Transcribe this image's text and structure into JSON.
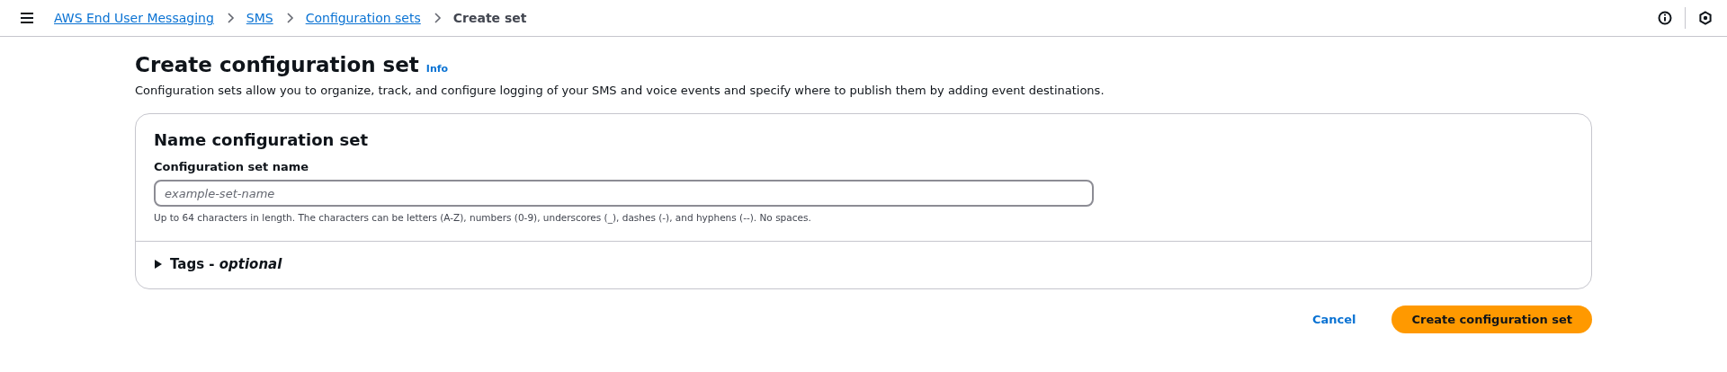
{
  "breadcrumbs": [
    {
      "label": "AWS End User Messaging",
      "current": false
    },
    {
      "label": "SMS",
      "current": false
    },
    {
      "label": "Configuration sets",
      "current": false
    },
    {
      "label": "Create set",
      "current": true
    }
  ],
  "page": {
    "title": "Create configuration set",
    "info": "Info",
    "description": "Configuration sets allow you to organize, track, and configure logging of your SMS and voice events and specify where to publish them by adding event destinations."
  },
  "card": {
    "title": "Name configuration set",
    "field": {
      "label": "Configuration set name",
      "placeholder": "example-set-name",
      "hint": "Up to 64 characters in length. The characters can be letters (A-Z), numbers (0-9), underscores (_), dashes (-), and hyphens (--). No spaces."
    },
    "tags": {
      "label": "Tags - *optional*",
      "expanded": false
    }
  },
  "actions": {
    "cancel": "Cancel",
    "submit": "Create configuration set"
  }
}
